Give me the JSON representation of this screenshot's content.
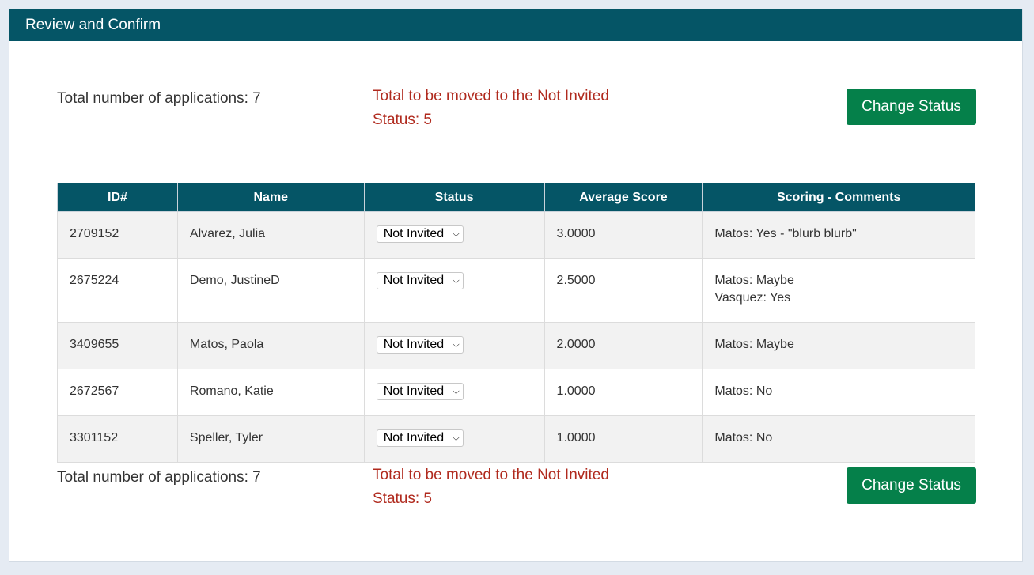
{
  "header": {
    "title": "Review and Confirm"
  },
  "summary": {
    "total_label": "Total number of applications: 7",
    "moved_line1": "Total to be moved to the Not Invited",
    "moved_line2": "Status: 5",
    "button_label": "Change Status"
  },
  "table": {
    "columns": [
      "ID#",
      "Name",
      "Status",
      "Average Score",
      "Scoring - Comments"
    ],
    "rows": [
      {
        "id": "2709152",
        "name": "Alvarez, Julia",
        "status": "Not Invited",
        "score": "3.0000",
        "comments": [
          "Matos: Yes - \"blurb blurb\""
        ]
      },
      {
        "id": "2675224",
        "name": "Demo, JustineD",
        "status": "Not Invited",
        "score": "2.5000",
        "comments": [
          "Matos: Maybe",
          "Vasquez: Yes"
        ]
      },
      {
        "id": "3409655",
        "name": "Matos, Paola",
        "status": "Not Invited",
        "score": "2.0000",
        "comments": [
          "Matos: Maybe"
        ]
      },
      {
        "id": "2672567",
        "name": "Romano, Katie",
        "status": "Not Invited",
        "score": "1.0000",
        "comments": [
          "Matos: No"
        ]
      },
      {
        "id": "3301152",
        "name": "Speller, Tyler",
        "status": "Not Invited",
        "score": "1.0000",
        "comments": [
          "Matos: No"
        ]
      }
    ]
  },
  "colors": {
    "header_bg": "#055566",
    "button_bg": "#05804a",
    "alert_text": "#b02a1e"
  }
}
